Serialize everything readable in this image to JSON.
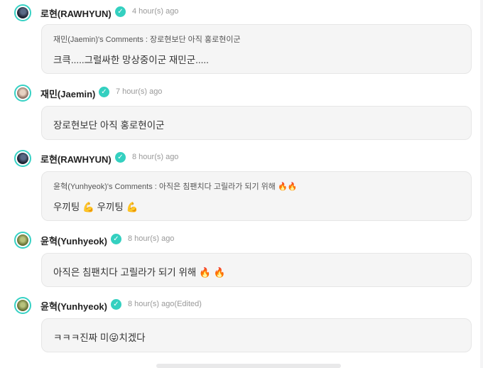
{
  "comments": [
    {
      "name": "로현(RAWHYUN)",
      "time": "4 hour(s) ago",
      "quote": "재민(Jaemin)'s Comments : 장로현보단 아직 홍로현이군",
      "text": "크큭.....그럴싸한 망상중이군 재민군.....",
      "avatar": "avatar-rawhyun"
    },
    {
      "name": "재민(Jaemin)",
      "time": "7 hour(s) ago",
      "text": "장로현보단 아직 홍로현이군",
      "avatar": "avatar-jaemin"
    },
    {
      "name": "로현(RAWHYUN)",
      "time": "8 hour(s) ago",
      "quote": "윤혁(Yunhyeok)'s Comments : 아직은 침팬치다 고릴라가 되기 위해 🔥🔥",
      "text": "우끼팅 💪 우끼팅 💪",
      "avatar": "avatar-rawhyun"
    },
    {
      "name": "윤혁(Yunhyeok)",
      "time": "8 hour(s) ago",
      "text": "아직은 침팬치다 고릴라가 되기 위해 🔥 🔥",
      "avatar": "avatar-yunhyeok"
    },
    {
      "name": "윤혁(Yunhyeok)",
      "time": "8 hour(s) ago(Edited)",
      "text": "ㅋㅋㅋ진짜 미😜치겠다",
      "avatar": "avatar-yunhyeok"
    }
  ],
  "icons": {
    "verified": "verified-check-icon"
  },
  "colors": {
    "verified": "#34d0c0",
    "avatar_ring": "#36d1c4",
    "bubble_bg": "#f5f5f5"
  }
}
